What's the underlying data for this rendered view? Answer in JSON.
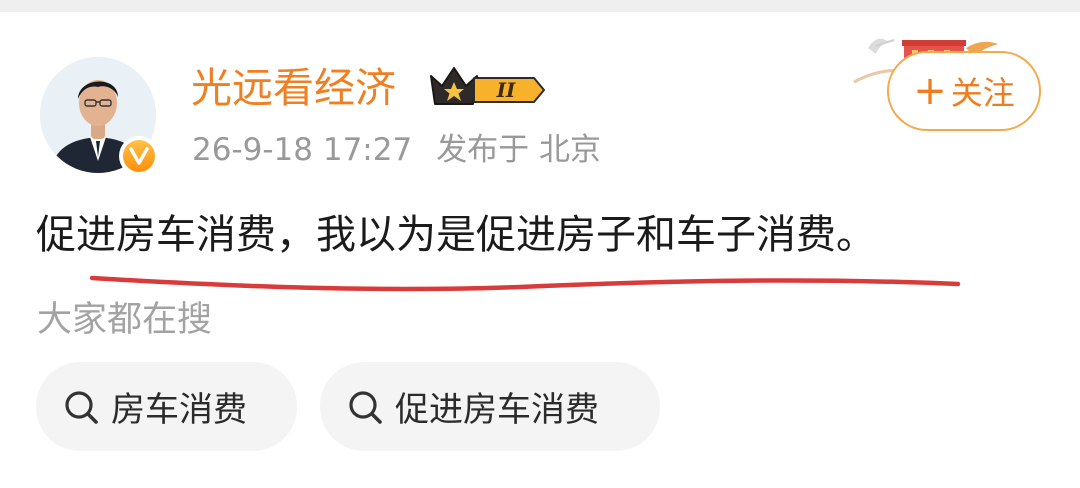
{
  "post": {
    "author": {
      "name": "光远看经济",
      "avatar_icon": "person-portrait",
      "verified_badge": "V",
      "level_badge": "II"
    },
    "meta": {
      "time": "26-9-18 17:27",
      "location": "发布于 北京"
    },
    "follow_button": {
      "plus": "+",
      "label": "关注"
    },
    "text": "促进房车消费，我以为是促进房子和车子消费。"
  },
  "related_search": {
    "label": "大家都在搜",
    "chips": [
      {
        "label": "房车消费",
        "icon": "search-icon"
      },
      {
        "label": "促进房车消费",
        "icon": "search-icon"
      }
    ]
  },
  "colors": {
    "username": "#f07f22",
    "follow_border": "#f3a94c",
    "underline": "#d93a3a",
    "meta_gray": "#999999",
    "chip_bg": "#f4f4f4"
  }
}
